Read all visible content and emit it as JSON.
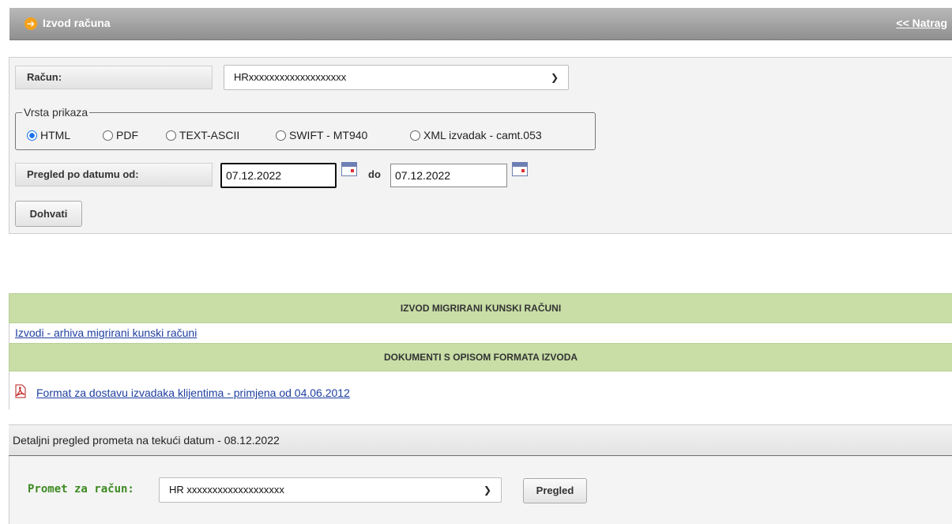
{
  "header": {
    "title": "Izvod računa",
    "back_label": "<< Natrag",
    "arrow_glyph": "➔"
  },
  "form": {
    "account_label": "Račun:",
    "account_value": "HRxxxxxxxxxxxxxxxxxxx",
    "display_type_legend": "Vrsta prikaza",
    "display_types": [
      {
        "label": "HTML",
        "selected": true
      },
      {
        "label": "PDF",
        "selected": false
      },
      {
        "label": "TEXT-ASCII",
        "selected": false
      },
      {
        "label": "SWIFT - MT940",
        "selected": false
      },
      {
        "label": "XML izvadak - camt.053",
        "selected": false
      }
    ],
    "date_label": "Pregled po datumu od:",
    "date_from": "07.12.2022",
    "date_to_label": "do",
    "date_to": "07.12.2022",
    "fetch_label": "Dohvati"
  },
  "sections": {
    "migrated_header": "IZVOD MIGRIRANI KUNSKI RAČUNI",
    "migrated_link": "Izvodi - arhiva migrirani kunski računi",
    "docs_header": "DOKUMENTI S OPISOM FORMATA IZVODA",
    "docs_link": "Format za dostavu izvadaka klijentima - primjena od 04.06.2012"
  },
  "detail": {
    "title": "Detaljni pregled prometa na tekući datum - 08.12.2022",
    "account_label": "Promet za račun:",
    "account_value": "HR xxxxxxxxxxxxxxxxxxx",
    "view_label": "Pregled"
  },
  "colors": {
    "accent_green": "#c8dea6",
    "label_green": "#3e8a22",
    "link_blue": "#1f3fa0",
    "header_grey": "#a3a3a3"
  }
}
